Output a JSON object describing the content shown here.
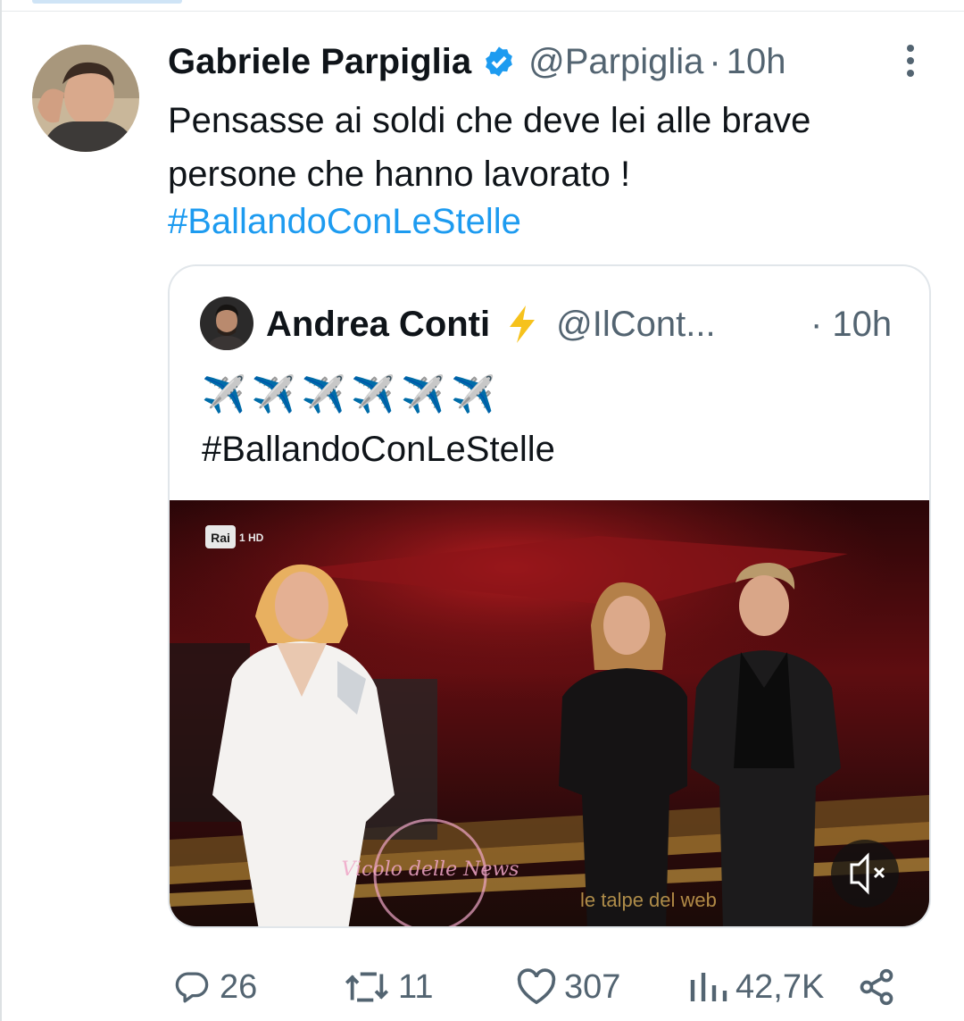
{
  "tweet": {
    "author_name": "Gabriele Parpiglia",
    "handle": "@Parpiglia",
    "dot": "·",
    "time": "10h",
    "text": "Pensasse ai soldi che deve lei alle brave persone che hanno lavorato !",
    "hashtag": "#BallandoConLeStelle"
  },
  "quote": {
    "author_name": "Andrea Conti",
    "handle": "@IlCont...",
    "time": "· 10h",
    "emoji_line": "✈️✈️✈️✈️✈️✈️",
    "hashtag": "#BallandoConLeStelle",
    "video": {
      "channel_logo": "Rai 1 HD",
      "watermark_text": "le talpe del web",
      "stamp_text": "Vicolo delle News"
    }
  },
  "actions": {
    "replies": "26",
    "retweets": "11",
    "likes": "307",
    "views": "42,7K"
  },
  "icons": {
    "verified": "verified-badge-icon",
    "bolt": "lightning-icon",
    "more": "more-vertical-icon",
    "reply": "reply-icon",
    "retweet": "retweet-icon",
    "like": "heart-icon",
    "views": "views-icon",
    "share": "share-icon",
    "mute": "mute-icon"
  },
  "colors": {
    "link": "#1d9bf0",
    "secondary_text": "#536471",
    "verified": "#1d9bf0",
    "bolt": "#f6c21c"
  }
}
